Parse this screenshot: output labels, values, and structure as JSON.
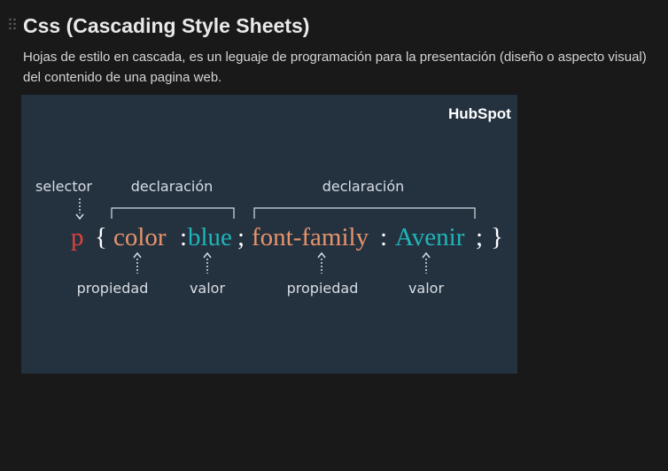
{
  "block": {
    "heading": "Css (Cascading Style Sheets)",
    "paragraph": "Hojas de estilo en cascada, es un leguaje de programación para la presentación (diseño o aspecto visual) del contenido de una pagina web."
  },
  "image": {
    "brand": "HubSpot",
    "labels": {
      "selector": "selector",
      "declaration_1": "declaración",
      "declaration_2": "declaración",
      "property_1": "propiedad",
      "value_1": "valor",
      "property_2": "propiedad",
      "value_2": "valor"
    },
    "code": {
      "selector": "p",
      "open_brace": "{",
      "property_1": "color",
      "colon_1": ":",
      "value_1": "blue",
      "semicolon_1": ";",
      "property_2": "font-family",
      "colon_2": ":",
      "value_2": "Avenir",
      "semicolon_2": ";",
      "close_brace": "}"
    },
    "colors": {
      "background": "#243240",
      "selector": "#e0403a",
      "property": "#e8936a",
      "value": "#1fb5b8",
      "punctuation": "#ffffff",
      "label": "#d8dde3"
    }
  }
}
